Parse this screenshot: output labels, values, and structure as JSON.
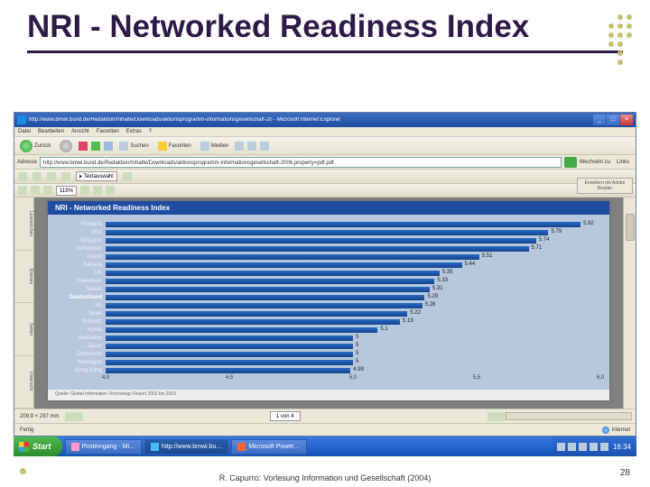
{
  "slide": {
    "title": "NRI - Networked Readiness Index",
    "footer": "R. Capurro: Vorlesung Information und Gesellschaft (2004)",
    "page_number": "28"
  },
  "ie": {
    "title": "http://www.bmwi.bund.de/Redaktion/Inhalte/Downloads/aktionsprogramm-informationsgesellschaft-20 - Microsoft Internet Explorer",
    "menu": [
      "Datei",
      "Bearbeiten",
      "Ansicht",
      "Favoriten",
      "Extras",
      "?"
    ],
    "back": "Zurück",
    "search": "Suchen",
    "favorites": "Favoriten",
    "media": "Medien",
    "address_label": "Adresse",
    "address_value": "http://www.bmwi.bund.de/Redaktion/Inhalte/Downloads/aktionsprogramm-informationsgesellschaft-2006,property=pdf.pdf",
    "go": "Wechseln zu",
    "links": "Links",
    "status": "Fertig",
    "zone": "Internet"
  },
  "adobe": {
    "text_select": "Textauswahl",
    "zoom": "119%",
    "side_tabs": [
      "Lesezeichen",
      "Ebenen",
      "Seiten",
      "Unterschr."
    ],
    "dimensions": "209,9 × 297 mm",
    "page_info": "1 von 4",
    "side_panel_r": "Erweitern mit Adobe Reader"
  },
  "chart_data": {
    "type": "bar",
    "title": "NRI - Networked Readiness Index",
    "orientation": "horizontal",
    "xlabel": "",
    "ylabel": "",
    "xlim": [
      4.0,
      6.0
    ],
    "ticks": [
      4.0,
      4.5,
      5.0,
      5.5,
      6.0
    ],
    "series": [
      {
        "name": "Finnland",
        "value": 5.92
      },
      {
        "name": "USA",
        "value": 5.79
      },
      {
        "name": "Singapur",
        "value": 5.74
      },
      {
        "name": "Schweden",
        "value": 5.71
      },
      {
        "name": "Island",
        "value": 5.51
      },
      {
        "name": "Kanada",
        "value": 5.44
      },
      {
        "name": "UK",
        "value": 5.35
      },
      {
        "name": "Dänemark",
        "value": 5.33
      },
      {
        "name": "Taiwan",
        "value": 5.31
      },
      {
        "name": "Deutschland",
        "value": 5.29,
        "highlight": true
      },
      {
        "name": "NL",
        "value": 5.28
      },
      {
        "name": "Israel",
        "value": 5.22
      },
      {
        "name": "Schweiz",
        "value": 5.19
      },
      {
        "name": "Korea",
        "value": 5.1
      },
      {
        "name": "Australien",
        "value": 5.0
      },
      {
        "name": "Japan",
        "value": 5.0
      },
      {
        "name": "Österreich",
        "value": 5.0
      },
      {
        "name": "Norwegen",
        "value": 5.0
      },
      {
        "name": "Hong Kong",
        "value": 4.99
      }
    ],
    "source": "Quelle: Global Information Technology Report 2002 bis 2003"
  },
  "taskbar": {
    "start": "Start",
    "items": [
      "Posteingang - Mi…",
      "http://www.bmwi.bu…",
      "Microsoft Power…"
    ],
    "clock": "16:34"
  }
}
